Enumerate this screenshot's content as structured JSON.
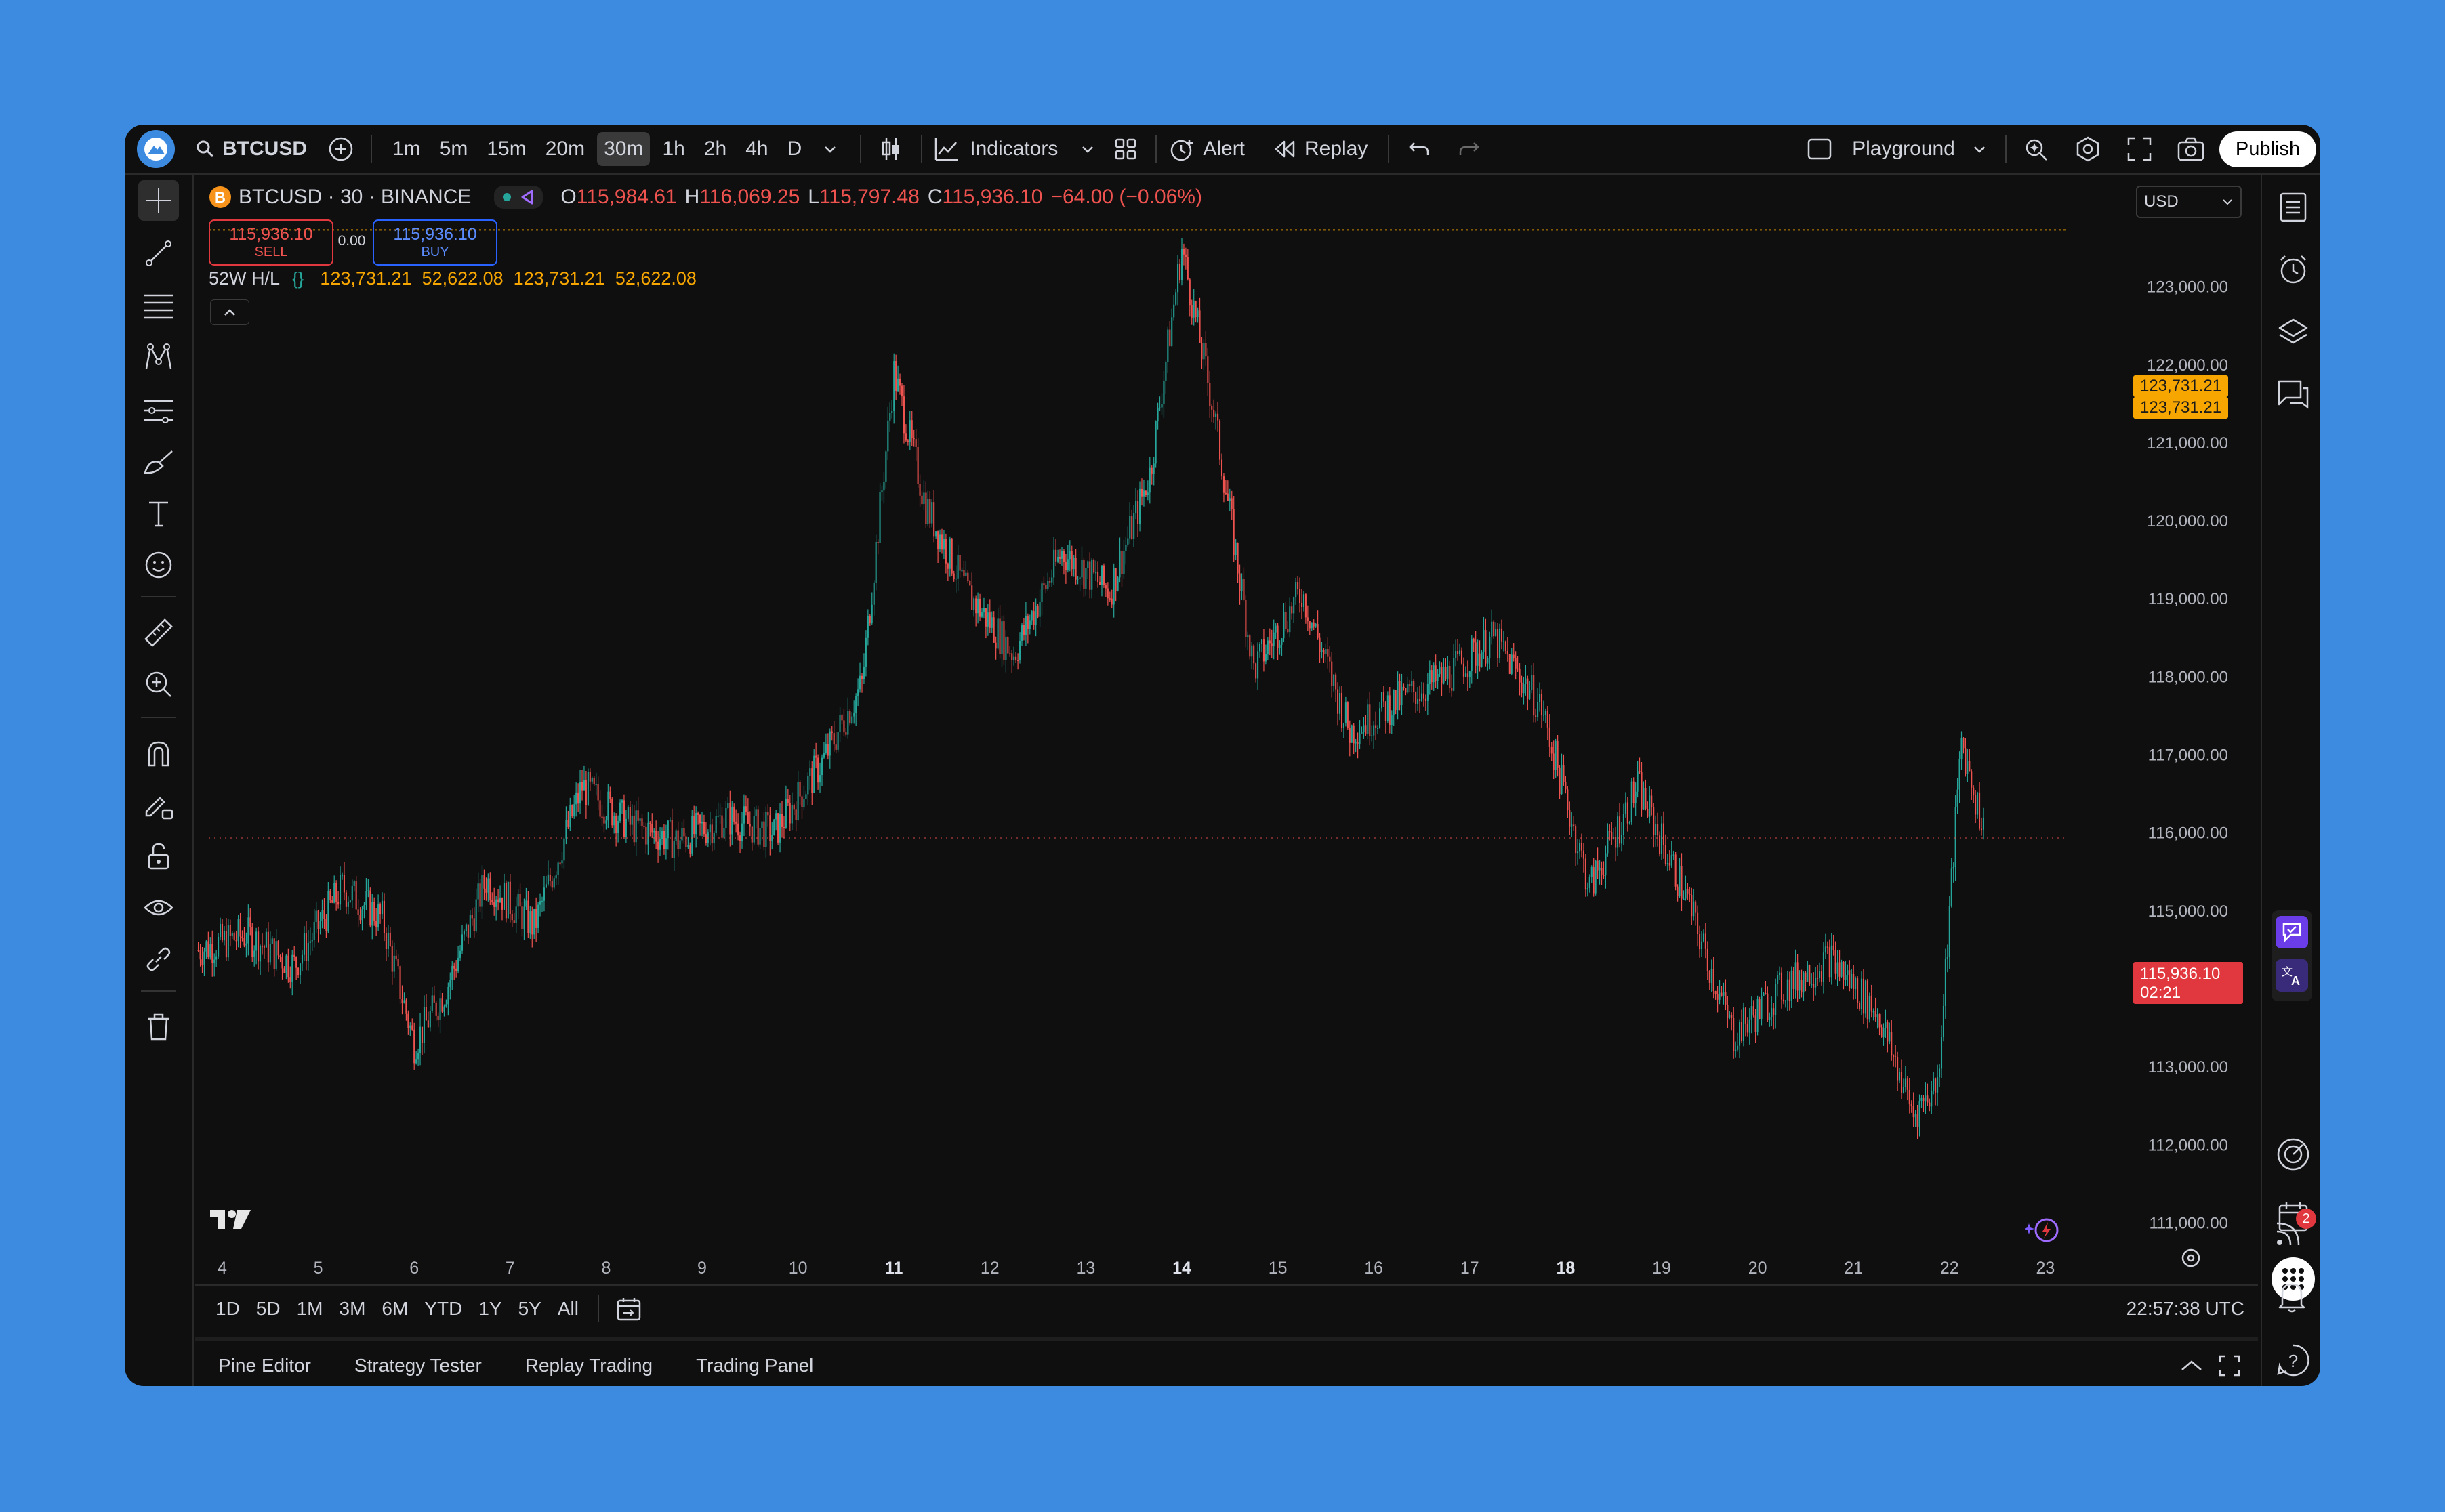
{
  "topbar": {
    "symbol": "BTCUSD",
    "timeframes": [
      "1m",
      "5m",
      "15m",
      "20m",
      "30m",
      "1h",
      "2h",
      "4h",
      "D"
    ],
    "active_timeframe": "30m",
    "indicators_label": "Indicators",
    "alert_label": "Alert",
    "replay_label": "Replay",
    "layout_label": "Playground",
    "publish_label": "Publish"
  },
  "legend": {
    "title": "BTCUSD · 30 · BINANCE",
    "o_label": "O",
    "o_value": "115,984.61",
    "h_label": "H",
    "h_value": "116,069.25",
    "l_label": "L",
    "l_value": "115,797.48",
    "c_label": "C",
    "c_value": "115,936.10",
    "change": "−64.00 (−0.06%)",
    "sell_price": "115,936.10",
    "sell_label": "SELL",
    "spread": "0.00",
    "buy_price": "115,936.10",
    "buy_label": "BUY",
    "indicator_name": "52W H/L",
    "indicator_values": "123,731.21  52,622.08  123,731.21  52,622.08"
  },
  "price_scale": {
    "currency": "USD",
    "ticks": [
      "123,000.00",
      "122,000.00",
      "121,000.00",
      "120,000.00",
      "119,000.00",
      "118,000.00",
      "117,000.00",
      "116,000.00",
      "115,000.00",
      "114,000.00",
      "113,000.00",
      "112,000.00",
      "111,000.00"
    ],
    "high_label_1": "123,731.21",
    "high_label_2": "123,731.21",
    "last_price": "115,936.10",
    "countdown": "02:21"
  },
  "time_scale": {
    "labels": [
      "4",
      "5",
      "6",
      "7",
      "8",
      "9",
      "10",
      "11",
      "12",
      "13",
      "14",
      "15",
      "16",
      "17",
      "18",
      "19",
      "20",
      "21",
      "22",
      "23"
    ],
    "bold": [
      "11",
      "14",
      "18"
    ]
  },
  "bottombar": {
    "ranges": [
      "1D",
      "5D",
      "1M",
      "3M",
      "6M",
      "YTD",
      "1Y",
      "5Y",
      "All"
    ],
    "clock": "22:57:38 UTC"
  },
  "bottom_panel": {
    "tabs": [
      "Pine Editor",
      "Strategy Tester",
      "Replay Trading",
      "Trading Panel"
    ]
  },
  "notifications": {
    "badge": "2"
  },
  "colors": {
    "up": "#26a69a",
    "down": "#ef5350",
    "accent_orange": "#f7a600",
    "last_price_bg": "#e0383e",
    "background": "#0f0f0f",
    "page_bg": "#3d8be0"
  },
  "chart_data": {
    "type": "candlestick",
    "symbol": "BTCUSD",
    "interval": "30",
    "exchange": "BINANCE",
    "x": [
      "4",
      "5",
      "6",
      "7",
      "8",
      "9",
      "10",
      "11",
      "12",
      "13",
      "14",
      "15",
      "16",
      "17",
      "18",
      "19",
      "20",
      "21",
      "22",
      "23"
    ],
    "close_path": [
      [
        "4",
        114500
      ],
      [
        "4",
        114700
      ],
      [
        "5",
        114300
      ],
      [
        "5",
        115300
      ],
      [
        "6",
        114900
      ],
      [
        "6",
        113300
      ],
      [
        "6",
        114000
      ],
      [
        "7",
        115400
      ],
      [
        "7",
        114800
      ],
      [
        "8",
        116600
      ],
      [
        "8",
        116100
      ],
      [
        "9",
        115900
      ],
      [
        "9",
        116200
      ],
      [
        "10",
        116000
      ],
      [
        "10",
        116900
      ],
      [
        "11",
        117900
      ],
      [
        "11",
        121900
      ],
      [
        "11",
        120200
      ],
      [
        "12",
        119100
      ],
      [
        "12",
        118300
      ],
      [
        "13",
        119600
      ],
      [
        "13",
        119100
      ],
      [
        "14",
        120600
      ],
      [
        "14",
        123500
      ],
      [
        "14",
        121400
      ],
      [
        "15",
        118100
      ],
      [
        "15",
        119100
      ],
      [
        "16",
        117300
      ],
      [
        "16",
        117700
      ],
      [
        "17",
        118000
      ],
      [
        "17",
        118500
      ],
      [
        "18",
        117600
      ],
      [
        "18",
        115300
      ],
      [
        "19",
        116600
      ],
      [
        "19",
        115200
      ],
      [
        "20",
        113400
      ],
      [
        "20",
        114000
      ],
      [
        "21",
        114400
      ],
      [
        "21",
        113700
      ],
      [
        "22",
        112400
      ],
      [
        "22",
        112800
      ],
      [
        "22",
        117200
      ],
      [
        "22",
        115936.1
      ]
    ],
    "ylim": [
      110700,
      123900
    ],
    "high_52w": 123731.21,
    "low_52w": 52622.08,
    "last": 115936.1
  }
}
